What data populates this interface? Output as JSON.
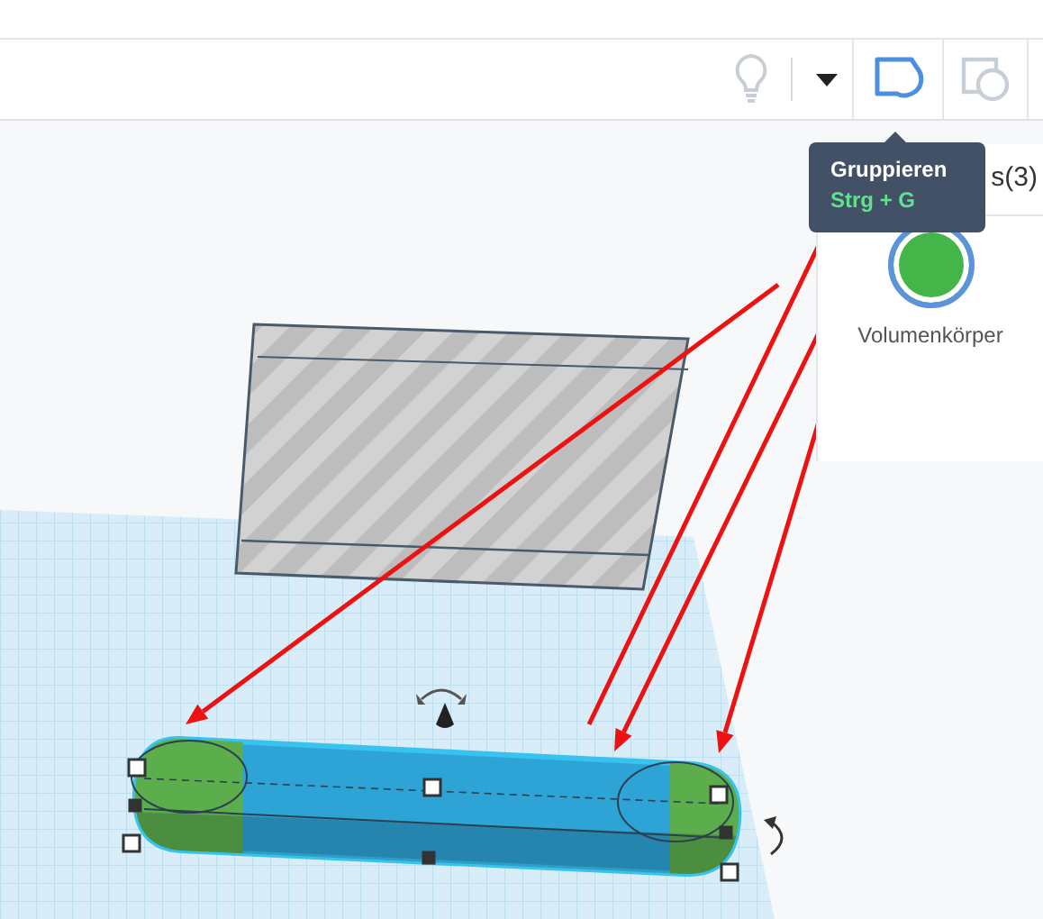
{
  "toolbar": [
    {
      "kind": "bulb",
      "disabled": true
    },
    {
      "kind": "dropdown",
      "disabled": false
    },
    {
      "kind": "group",
      "disabled": false
    },
    {
      "kind": "ungroup",
      "disabled": true
    }
  ],
  "tooltip": {
    "title": "Gruppieren",
    "shortcut": "Strg + G"
  },
  "shape_panel": {
    "header": "s(3)",
    "items": [
      {
        "label": "Volumenkörper",
        "selected": true
      }
    ]
  }
}
